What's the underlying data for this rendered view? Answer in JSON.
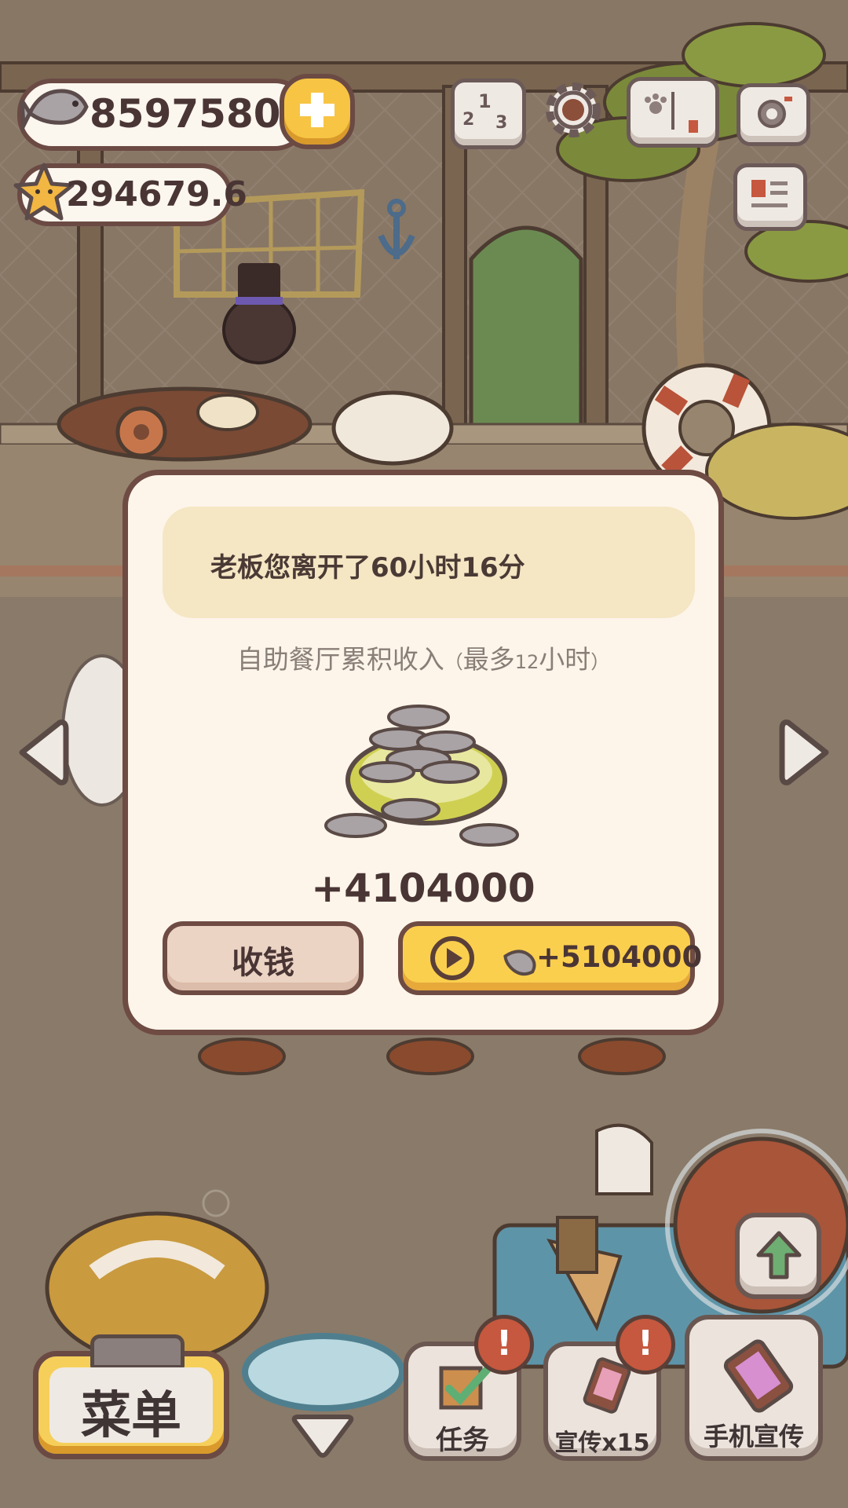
{
  "hud": {
    "fish_coins": "8597580",
    "stars": "294679.6"
  },
  "dialog": {
    "message": "老板您离开了60小时16分",
    "subtitle_main": "自助餐厅累积收入",
    "subtitle_paren_open": "（",
    "subtitle_max_label": "最多",
    "subtitle_hours_number": "12",
    "subtitle_hours_unit": "小时",
    "subtitle_paren_close": "）",
    "earned_amount": "+4104000",
    "collect_button": "收钱",
    "ad_button_amount": "+5104000"
  },
  "bottom_bar": {
    "menu_button": "菜单",
    "tasks_button": "任务",
    "promote_button": "宣传x15",
    "phone_promote_button": "手机宣传",
    "alert_badge": "!"
  },
  "colors": {
    "accent_yellow": "#fbcf4e",
    "outline_brown": "#6e4b43",
    "panel_cream": "#fdf5ea",
    "message_bg": "#f5e6c4",
    "alert_red": "#c5583e"
  },
  "icons": {
    "fish": "fish-icon",
    "star": "star-icon",
    "plus": "plus-icon",
    "ranking": "ranking-podium-icon",
    "settings": "gear-icon",
    "book": "paw-book-icon",
    "camera": "camera-icon",
    "card": "id-card-icon",
    "play": "play-icon",
    "upgrade": "up-arrow-icon"
  }
}
